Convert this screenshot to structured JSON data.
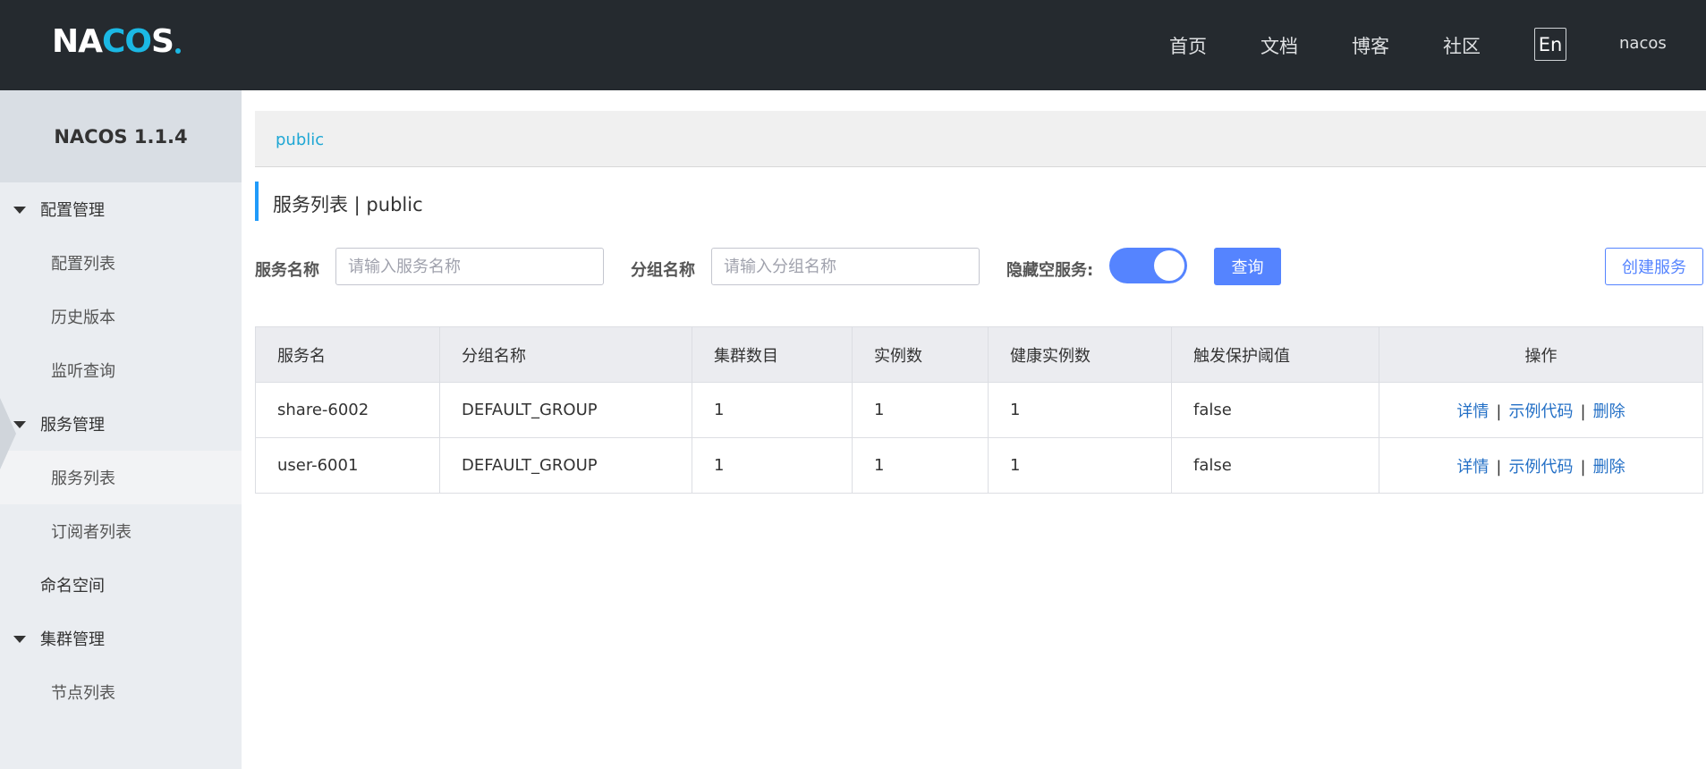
{
  "header": {
    "logo": "NACOS",
    "nav": [
      "首页",
      "文档",
      "博客",
      "社区"
    ],
    "lang_button": "En",
    "user": "nacos"
  },
  "sidebar": {
    "title": "NACOS 1.1.4",
    "groups": [
      {
        "label": "配置管理",
        "items": [
          "配置列表",
          "历史版本",
          "监听查询"
        ]
      },
      {
        "label": "服务管理",
        "items": [
          "服务列表",
          "订阅者列表"
        ]
      },
      {
        "label": "命名空间",
        "items": []
      },
      {
        "label": "集群管理",
        "items": [
          "节点列表"
        ]
      }
    ],
    "active_item": "服务列表"
  },
  "breadcrumb": "public",
  "page_title": "服务列表  |  public",
  "search": {
    "service_name_label": "服务名称",
    "service_name_placeholder": "请输入服务名称",
    "group_name_label": "分组名称",
    "group_name_placeholder": "请输入分组名称",
    "hide_empty_label": "隐藏空服务:",
    "hide_empty_on": true,
    "query_button": "查询",
    "create_button": "创建服务"
  },
  "table": {
    "columns": [
      "服务名",
      "分组名称",
      "集群数目",
      "实例数",
      "健康实例数",
      "触发保护阈值",
      "操作"
    ],
    "rows": [
      {
        "name": "share-6002",
        "group": "DEFAULT_GROUP",
        "clusters": "1",
        "instances": "1",
        "healthy": "1",
        "protect": "false"
      },
      {
        "name": "user-6001",
        "group": "DEFAULT_GROUP",
        "clusters": "1",
        "instances": "1",
        "healthy": "1",
        "protect": "false"
      }
    ],
    "actions": {
      "detail": "详情",
      "sample_code": "示例代码",
      "delete": "删除",
      "separator": "|"
    }
  },
  "colors": {
    "header_bg": "#252a2f",
    "accent": "#5584ff",
    "link": "#2470c6",
    "breadcrumb": "#1fa7d4"
  }
}
